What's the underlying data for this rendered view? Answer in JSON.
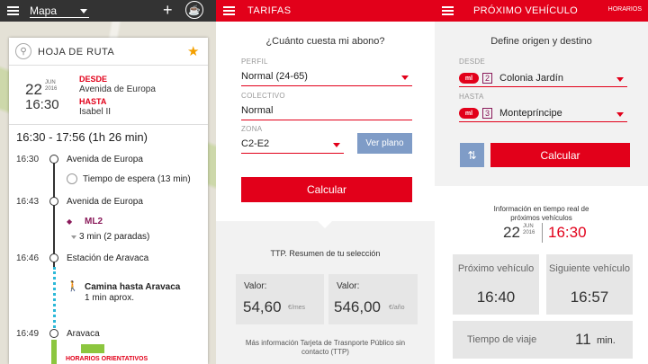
{
  "screen1": {
    "header_title": "Mapa",
    "route_title": "HOJA DE RUTA",
    "date_day": "22",
    "date_month": "JUN",
    "date_year": "2016",
    "time": "16:30",
    "from_label": "DESDE",
    "from_value": "Avenida de Europa",
    "to_label": "HASTA",
    "to_value": "Isabel II",
    "duration": "16:30 - 17:56 (1h 26 min)",
    "timeline": [
      {
        "time": "16:30",
        "text": "Avenida de Europa"
      },
      {
        "time": "",
        "text": "Tiempo de espera (13 min)"
      },
      {
        "time": "16:43",
        "text": "Avenida de Europa"
      },
      {
        "time": "",
        "text": "ML2"
      },
      {
        "time": "",
        "text": "3 min (2 paradas)"
      },
      {
        "time": "16:46",
        "text": "Estación de Aravaca"
      },
      {
        "time": "",
        "text": "Camina hasta Aravaca"
      },
      {
        "time": "",
        "text": "1 min aprox."
      },
      {
        "time": "16:49",
        "text": "Aravaca"
      }
    ],
    "footer_note": "HORARIOS ORIENTATIVOS",
    "colors": {
      "accent": "#e2001a",
      "star": "#f4a000",
      "walk": "#2bb8d8",
      "line": "#8a1a5a"
    }
  },
  "screen2": {
    "header_title": "TARIFAS",
    "question": "¿Cuánto cuesta mi abono?",
    "perfil_label": "PERFIL",
    "perfil_value": "Normal (24-65)",
    "colectivo_label": "COLECTIVO",
    "colectivo_value": "Normal",
    "zona_label": "ZONA",
    "zona_value": "C2-E2",
    "ver_plano": "Ver plano",
    "calcular": "Calcular",
    "summary": "TTP. Resumen de tu selección",
    "valor1_label": "Valor:",
    "valor1_value": "54,60",
    "valor1_unit": "€/mes",
    "valor2_label": "Valor:",
    "valor2_value": "546,00",
    "valor2_unit": "€/año",
    "more_info": "Más información Tarjeta de Trasnporte Público sin contacto (TTP)"
  },
  "screen3": {
    "header_title": "PRÓXIMO VEHÍCULO",
    "horarios": "HORARIOS",
    "define": "Define origen y destino",
    "desde_label": "DESDE",
    "desde_line": "2",
    "desde_value": "Colonia Jardín",
    "hasta_label": "HASTA",
    "hasta_line": "3",
    "hasta_value": "Montepríncipe",
    "ml_label": "ml",
    "calcular": "Calcular",
    "info": "Información en tiempo real de próximos vehículos",
    "date_day": "22",
    "date_month": "JUN",
    "date_year": "2016",
    "time": "16:30",
    "proximo_label": "Próximo vehículo",
    "proximo_value": "16:40",
    "siguiente_label": "Siguiente vehículo",
    "siguiente_value": "16:57",
    "viaje_label": "Tiempo de viaje",
    "viaje_value": "11",
    "viaje_unit": "min."
  }
}
